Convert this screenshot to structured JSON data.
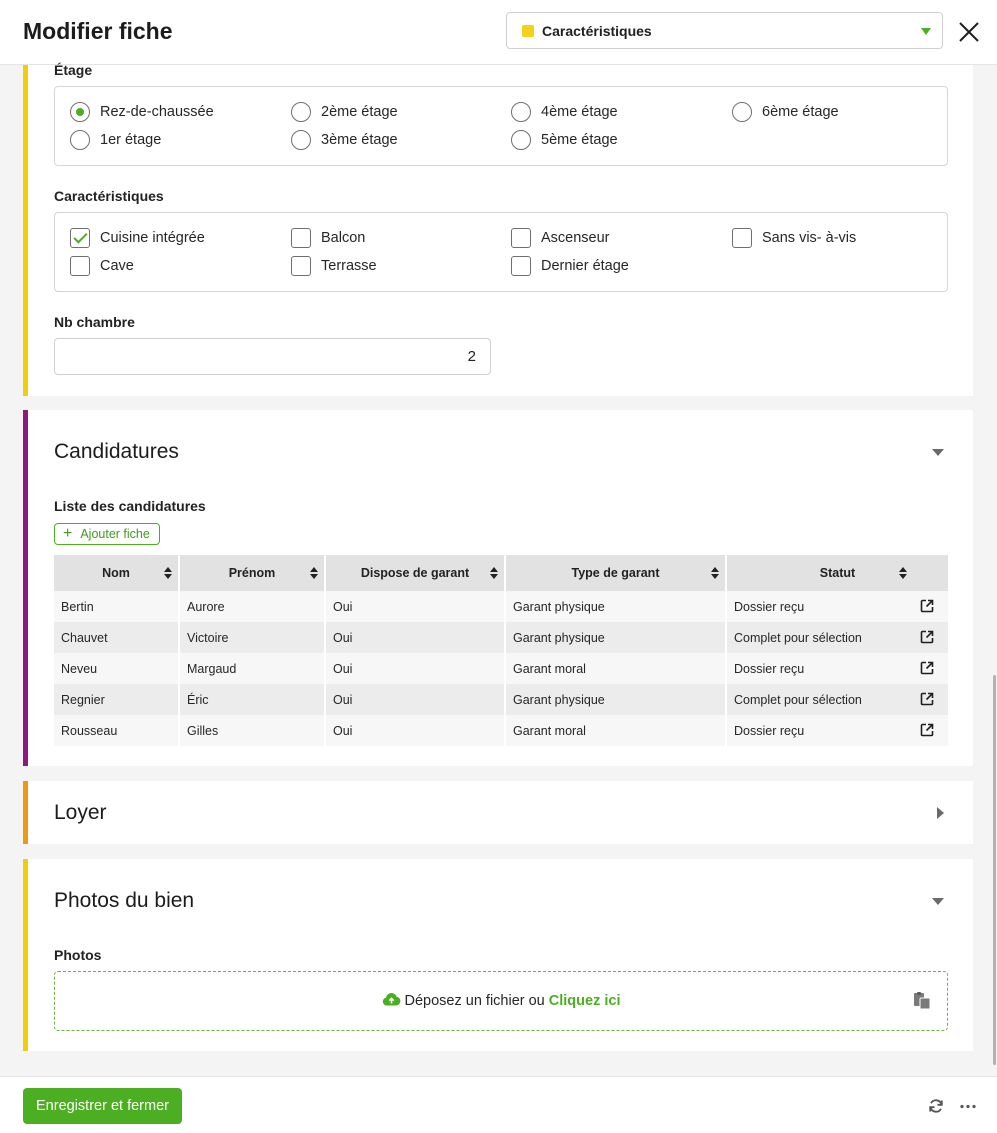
{
  "header": {
    "title": "Modifier fiche",
    "section_select": {
      "value": "Caractéristiques",
      "dot_color": "#f7d117"
    }
  },
  "characteristics": {
    "etage": {
      "label": "Étage",
      "options": [
        "Rez-de-chaussée",
        "1er étage",
        "2ème étage",
        "3ème étage",
        "4ème étage",
        "5ème étage",
        "6ème étage"
      ],
      "selected": "Rez-de-chaussée"
    },
    "caracteristiques": {
      "label": "Caractéristiques",
      "options": [
        "Cuisine intégrée",
        "Cave",
        "Balcon",
        "Terrasse",
        "Ascenseur",
        "Dernier étage",
        "Sans vis- à-vis"
      ],
      "checked": [
        "Cuisine intégrée"
      ]
    },
    "nb_chambre": {
      "label": "Nb chambre",
      "value": "2"
    }
  },
  "candidatures": {
    "title": "Candidatures",
    "list_label": "Liste des candidatures",
    "add_button": "Ajouter fiche",
    "columns": [
      "Nom",
      "Prénom",
      "Dispose de garant",
      "Type de garant",
      "Statut"
    ],
    "rows": [
      [
        "Bertin",
        "Aurore",
        "Oui",
        "Garant physique",
        "Dossier reçu"
      ],
      [
        "Chauvet",
        "Victoire",
        "Oui",
        "Garant physique",
        "Complet pour sélection"
      ],
      [
        "Neveu",
        "Margaud",
        "Oui",
        "Garant moral",
        "Dossier reçu"
      ],
      [
        "Regnier",
        "Éric",
        "Oui",
        "Garant physique",
        "Complet pour sélection"
      ],
      [
        "Rousseau",
        "Gilles",
        "Oui",
        "Garant moral",
        "Dossier reçu"
      ]
    ]
  },
  "loyer": {
    "title": "Loyer"
  },
  "photos": {
    "title": "Photos du bien",
    "label": "Photos",
    "drop_text": "Déposez un fichier ou",
    "drop_link": "Cliquez ici"
  },
  "footer": {
    "save_label": "Enregistrer et fermer"
  },
  "colors": {
    "accent": "#4caf22",
    "section_yellow": "#f2ce0a",
    "section_purple": "#8a1a7d",
    "section_orange": "#ec9a12"
  }
}
